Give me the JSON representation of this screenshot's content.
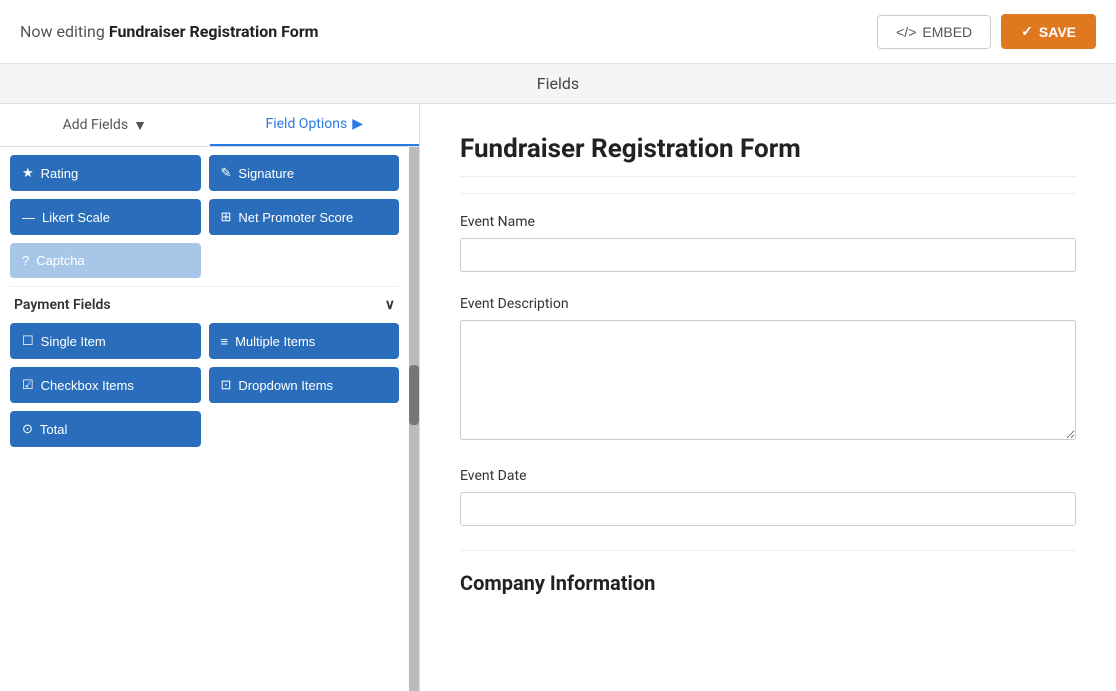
{
  "header": {
    "editing_label": "Now editing",
    "form_name": "Fundraiser Registration Form",
    "embed_label": "EMBED",
    "save_label": "SAVE",
    "embed_icon": "</>",
    "save_icon": "✓"
  },
  "fields_tab_label": "Fields",
  "tabs": [
    {
      "id": "add-fields",
      "label": "Add Fields",
      "icon": "▼",
      "active": false
    },
    {
      "id": "field-options",
      "label": "Field Options",
      "icon": "▶",
      "active": true
    }
  ],
  "field_buttons_row1": [
    {
      "id": "rating",
      "label": "Rating",
      "icon": "★"
    },
    {
      "id": "signature",
      "label": "Signature",
      "icon": "✎"
    }
  ],
  "field_buttons_row2": [
    {
      "id": "likert-scale",
      "label": "Likert Scale",
      "icon": "—"
    },
    {
      "id": "net-promoter-score",
      "label": "Net Promoter Score",
      "icon": "⊞"
    }
  ],
  "field_buttons_row3": [
    {
      "id": "captcha",
      "label": "Captcha",
      "icon": "?",
      "light": true
    }
  ],
  "payment_section": {
    "label": "Payment Fields",
    "icon": "∨"
  },
  "payment_buttons_row1": [
    {
      "id": "single-item",
      "label": "Single Item",
      "icon": "☐"
    },
    {
      "id": "multiple-items",
      "label": "Multiple Items",
      "icon": "≡"
    }
  ],
  "payment_buttons_row2": [
    {
      "id": "checkbox-items",
      "label": "Checkbox Items",
      "icon": "☑"
    },
    {
      "id": "dropdown-items",
      "label": "Dropdown Items",
      "icon": "⊡"
    }
  ],
  "payment_buttons_row3": [
    {
      "id": "total",
      "label": "Total",
      "icon": "⊙"
    }
  ],
  "form": {
    "title": "Fundraiser Registration Form",
    "fields": [
      {
        "id": "event-name",
        "label": "Event Name",
        "type": "input",
        "placeholder": ""
      },
      {
        "id": "event-description",
        "label": "Event Description",
        "type": "textarea",
        "placeholder": ""
      },
      {
        "id": "event-date",
        "label": "Event Date",
        "type": "input",
        "placeholder": ""
      }
    ],
    "section": "Company Information"
  },
  "colors": {
    "btn_primary": "#2a6ebb",
    "btn_light": "#a8c6e8",
    "btn_save": "#e07820",
    "tab_active": "#2a7ae4"
  }
}
